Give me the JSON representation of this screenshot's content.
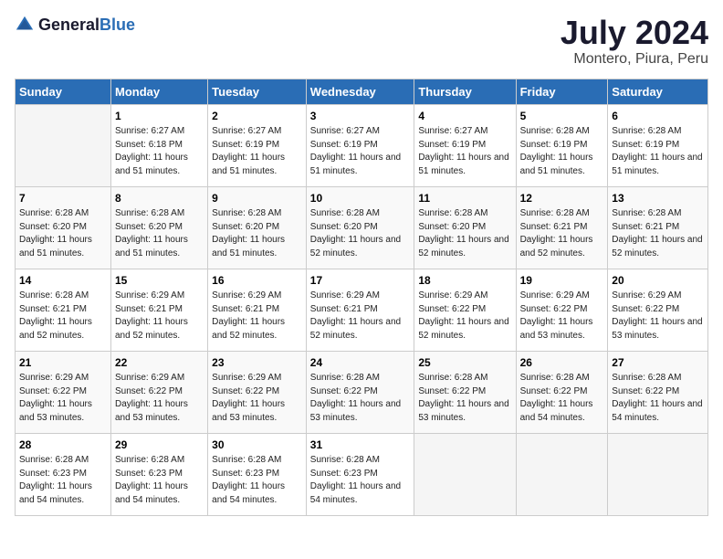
{
  "header": {
    "logo_general": "General",
    "logo_blue": "Blue",
    "month": "July 2024",
    "location": "Montero, Piura, Peru"
  },
  "days_of_week": [
    "Sunday",
    "Monday",
    "Tuesday",
    "Wednesday",
    "Thursday",
    "Friday",
    "Saturday"
  ],
  "weeks": [
    [
      {
        "day": "",
        "empty": true
      },
      {
        "day": "1",
        "sunrise": "6:27 AM",
        "sunset": "6:18 PM",
        "daylight": "11 hours and 51 minutes."
      },
      {
        "day": "2",
        "sunrise": "6:27 AM",
        "sunset": "6:19 PM",
        "daylight": "11 hours and 51 minutes."
      },
      {
        "day": "3",
        "sunrise": "6:27 AM",
        "sunset": "6:19 PM",
        "daylight": "11 hours and 51 minutes."
      },
      {
        "day": "4",
        "sunrise": "6:27 AM",
        "sunset": "6:19 PM",
        "daylight": "11 hours and 51 minutes."
      },
      {
        "day": "5",
        "sunrise": "6:28 AM",
        "sunset": "6:19 PM",
        "daylight": "11 hours and 51 minutes."
      },
      {
        "day": "6",
        "sunrise": "6:28 AM",
        "sunset": "6:19 PM",
        "daylight": "11 hours and 51 minutes."
      }
    ],
    [
      {
        "day": "7",
        "sunrise": "6:28 AM",
        "sunset": "6:20 PM",
        "daylight": "11 hours and 51 minutes."
      },
      {
        "day": "8",
        "sunrise": "6:28 AM",
        "sunset": "6:20 PM",
        "daylight": "11 hours and 51 minutes."
      },
      {
        "day": "9",
        "sunrise": "6:28 AM",
        "sunset": "6:20 PM",
        "daylight": "11 hours and 51 minutes."
      },
      {
        "day": "10",
        "sunrise": "6:28 AM",
        "sunset": "6:20 PM",
        "daylight": "11 hours and 52 minutes."
      },
      {
        "day": "11",
        "sunrise": "6:28 AM",
        "sunset": "6:20 PM",
        "daylight": "11 hours and 52 minutes."
      },
      {
        "day": "12",
        "sunrise": "6:28 AM",
        "sunset": "6:21 PM",
        "daylight": "11 hours and 52 minutes."
      },
      {
        "day": "13",
        "sunrise": "6:28 AM",
        "sunset": "6:21 PM",
        "daylight": "11 hours and 52 minutes."
      }
    ],
    [
      {
        "day": "14",
        "sunrise": "6:28 AM",
        "sunset": "6:21 PM",
        "daylight": "11 hours and 52 minutes."
      },
      {
        "day": "15",
        "sunrise": "6:29 AM",
        "sunset": "6:21 PM",
        "daylight": "11 hours and 52 minutes."
      },
      {
        "day": "16",
        "sunrise": "6:29 AM",
        "sunset": "6:21 PM",
        "daylight": "11 hours and 52 minutes."
      },
      {
        "day": "17",
        "sunrise": "6:29 AM",
        "sunset": "6:21 PM",
        "daylight": "11 hours and 52 minutes."
      },
      {
        "day": "18",
        "sunrise": "6:29 AM",
        "sunset": "6:22 PM",
        "daylight": "11 hours and 52 minutes."
      },
      {
        "day": "19",
        "sunrise": "6:29 AM",
        "sunset": "6:22 PM",
        "daylight": "11 hours and 53 minutes."
      },
      {
        "day": "20",
        "sunrise": "6:29 AM",
        "sunset": "6:22 PM",
        "daylight": "11 hours and 53 minutes."
      }
    ],
    [
      {
        "day": "21",
        "sunrise": "6:29 AM",
        "sunset": "6:22 PM",
        "daylight": "11 hours and 53 minutes."
      },
      {
        "day": "22",
        "sunrise": "6:29 AM",
        "sunset": "6:22 PM",
        "daylight": "11 hours and 53 minutes."
      },
      {
        "day": "23",
        "sunrise": "6:29 AM",
        "sunset": "6:22 PM",
        "daylight": "11 hours and 53 minutes."
      },
      {
        "day": "24",
        "sunrise": "6:28 AM",
        "sunset": "6:22 PM",
        "daylight": "11 hours and 53 minutes."
      },
      {
        "day": "25",
        "sunrise": "6:28 AM",
        "sunset": "6:22 PM",
        "daylight": "11 hours and 53 minutes."
      },
      {
        "day": "26",
        "sunrise": "6:28 AM",
        "sunset": "6:22 PM",
        "daylight": "11 hours and 54 minutes."
      },
      {
        "day": "27",
        "sunrise": "6:28 AM",
        "sunset": "6:22 PM",
        "daylight": "11 hours and 54 minutes."
      }
    ],
    [
      {
        "day": "28",
        "sunrise": "6:28 AM",
        "sunset": "6:23 PM",
        "daylight": "11 hours and 54 minutes."
      },
      {
        "day": "29",
        "sunrise": "6:28 AM",
        "sunset": "6:23 PM",
        "daylight": "11 hours and 54 minutes."
      },
      {
        "day": "30",
        "sunrise": "6:28 AM",
        "sunset": "6:23 PM",
        "daylight": "11 hours and 54 minutes."
      },
      {
        "day": "31",
        "sunrise": "6:28 AM",
        "sunset": "6:23 PM",
        "daylight": "11 hours and 54 minutes."
      },
      {
        "day": "",
        "empty": true
      },
      {
        "day": "",
        "empty": true
      },
      {
        "day": "",
        "empty": true
      }
    ]
  ]
}
